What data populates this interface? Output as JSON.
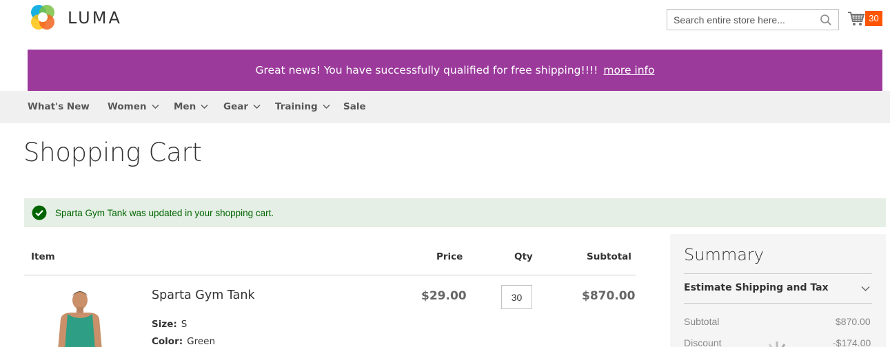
{
  "brand": {
    "name": "LUMA"
  },
  "search": {
    "placeholder": "Search entire store here..."
  },
  "minicart": {
    "count": "30"
  },
  "promo": {
    "text": "Great news! You have successfully qualified for free shipping!!!!",
    "link": "more info"
  },
  "nav": {
    "items": [
      {
        "label": "What's New",
        "dropdown": false
      },
      {
        "label": "Women",
        "dropdown": true
      },
      {
        "label": "Men",
        "dropdown": true
      },
      {
        "label": "Gear",
        "dropdown": true
      },
      {
        "label": "Training",
        "dropdown": true
      },
      {
        "label": "Sale",
        "dropdown": false
      }
    ]
  },
  "page": {
    "title": "Shopping Cart"
  },
  "message": {
    "text": "Sparta Gym Tank was updated in your shopping cart."
  },
  "cart": {
    "headers": {
      "item": "Item",
      "price": "Price",
      "qty": "Qty",
      "subtotal": "Subtotal"
    },
    "items": [
      {
        "name": "Sparta Gym Tank",
        "price": "$29.00",
        "qty": "30",
        "subtotal": "$870.00",
        "options": [
          {
            "label": "Size:",
            "value": "S"
          },
          {
            "label": "Color:",
            "value": "Green"
          }
        ]
      }
    ]
  },
  "summary": {
    "title": "Summary",
    "estimate_label": "Estimate Shipping and Tax",
    "rows": [
      {
        "label": "Subtotal",
        "value": "$870.00"
      },
      {
        "label": "Discount",
        "value": "-$174.00"
      }
    ]
  },
  "colors": {
    "promo": "#9c3a9c",
    "cart_badge": "#ff5501",
    "success_bg": "#e5efe5"
  }
}
